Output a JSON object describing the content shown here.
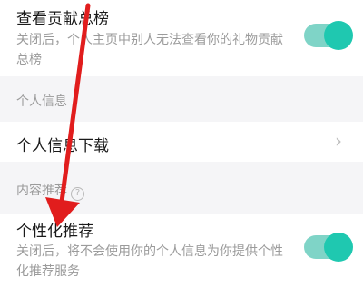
{
  "contribution": {
    "title": "查看贡献总榜",
    "description": "关闭后，个人主页中别人无法查看你的礼物贡献总榜",
    "toggle_on": true
  },
  "personal_info": {
    "group_label": "个人信息",
    "download_label": "个人信息下载",
    "chevron": "chevron-right-icon"
  },
  "content_rec": {
    "group_label": "内容推荐",
    "help_glyph": "?",
    "title": "个性化推荐",
    "description": "关闭后，将不会使用你的个人信息为你提供个性化推荐服务",
    "toggle_on": true
  },
  "annotation": {
    "arrow_color": "#e11d1d"
  },
  "colors": {
    "toggle_track": "#7fd4c7",
    "toggle_knob": "#1fc8b0",
    "group_bg": "#f5f5f7"
  }
}
